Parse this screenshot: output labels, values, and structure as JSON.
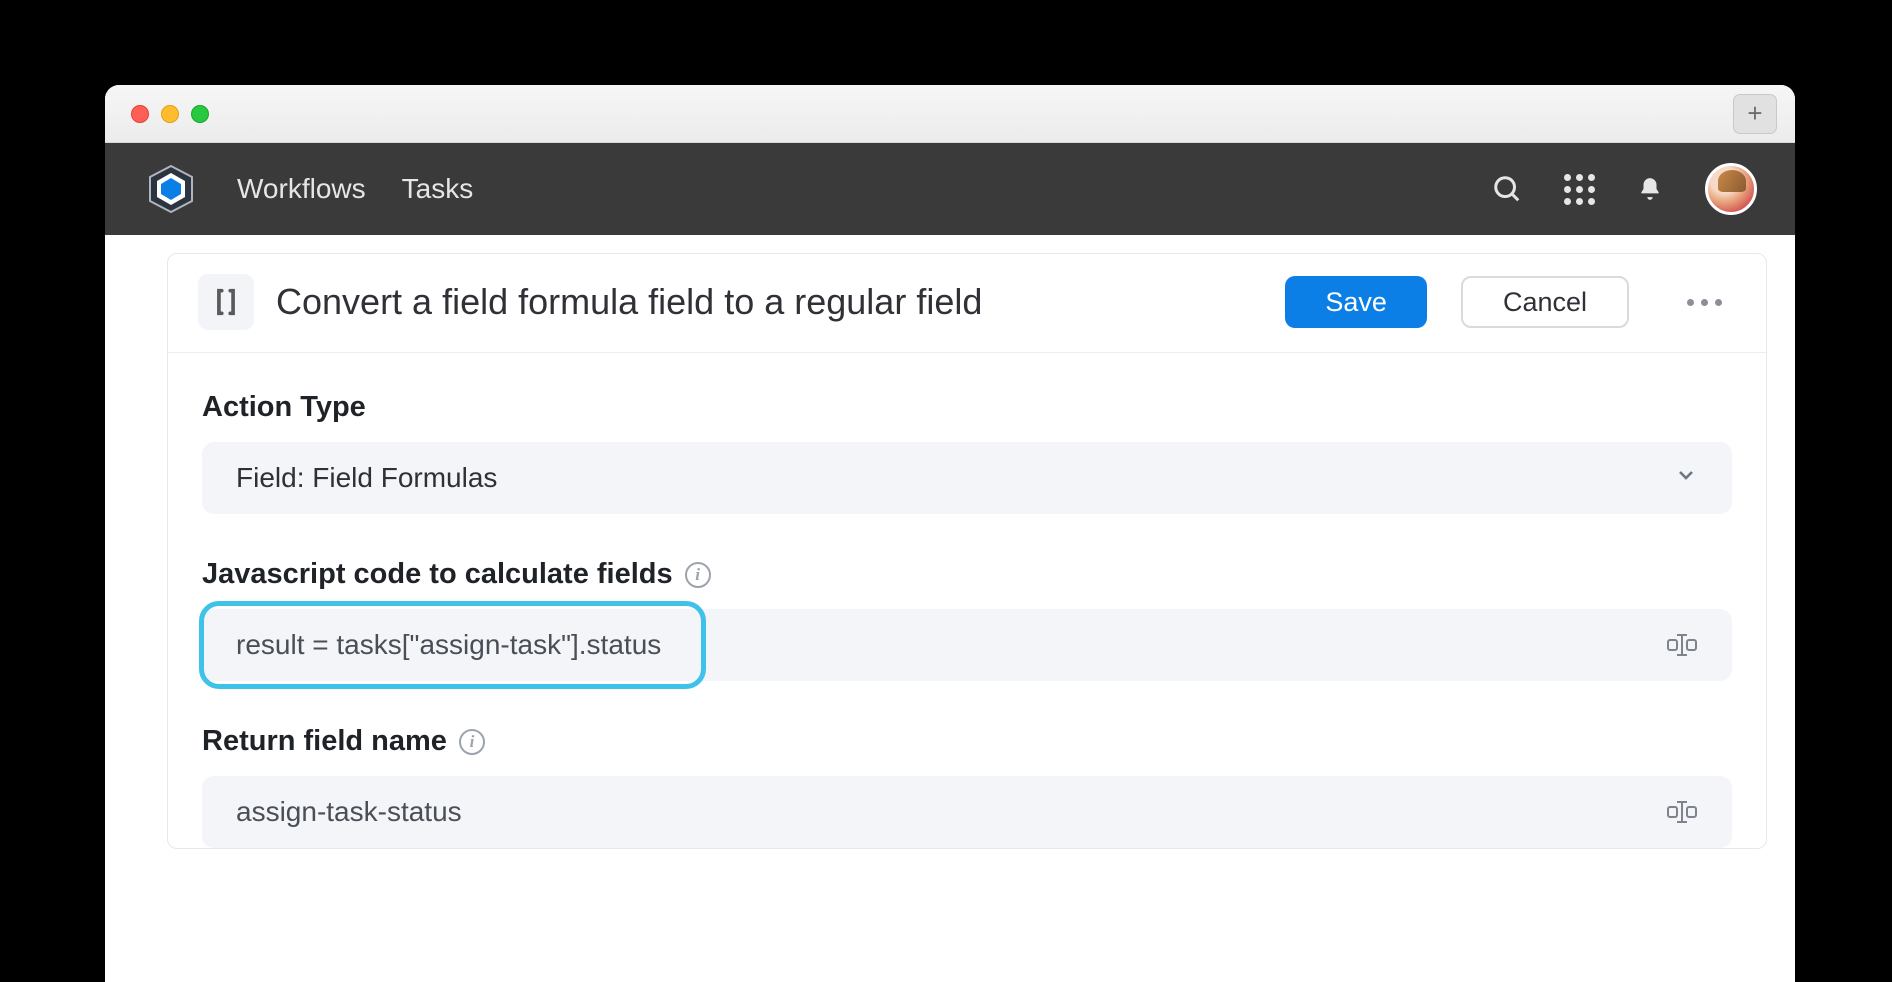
{
  "nav": {
    "links": [
      "Workflows",
      "Tasks"
    ]
  },
  "header": {
    "title": "Convert a field formula field to a regular field",
    "save_label": "Save",
    "cancel_label": "Cancel"
  },
  "sections": {
    "action_type": {
      "label": "Action Type",
      "value": "Field: Field Formulas"
    },
    "js_code": {
      "label": "Javascript code to calculate fields",
      "value": "result = tasks[\"assign-task\"].status"
    },
    "return_field": {
      "label": "Return field name",
      "value": "assign-task-status"
    }
  }
}
